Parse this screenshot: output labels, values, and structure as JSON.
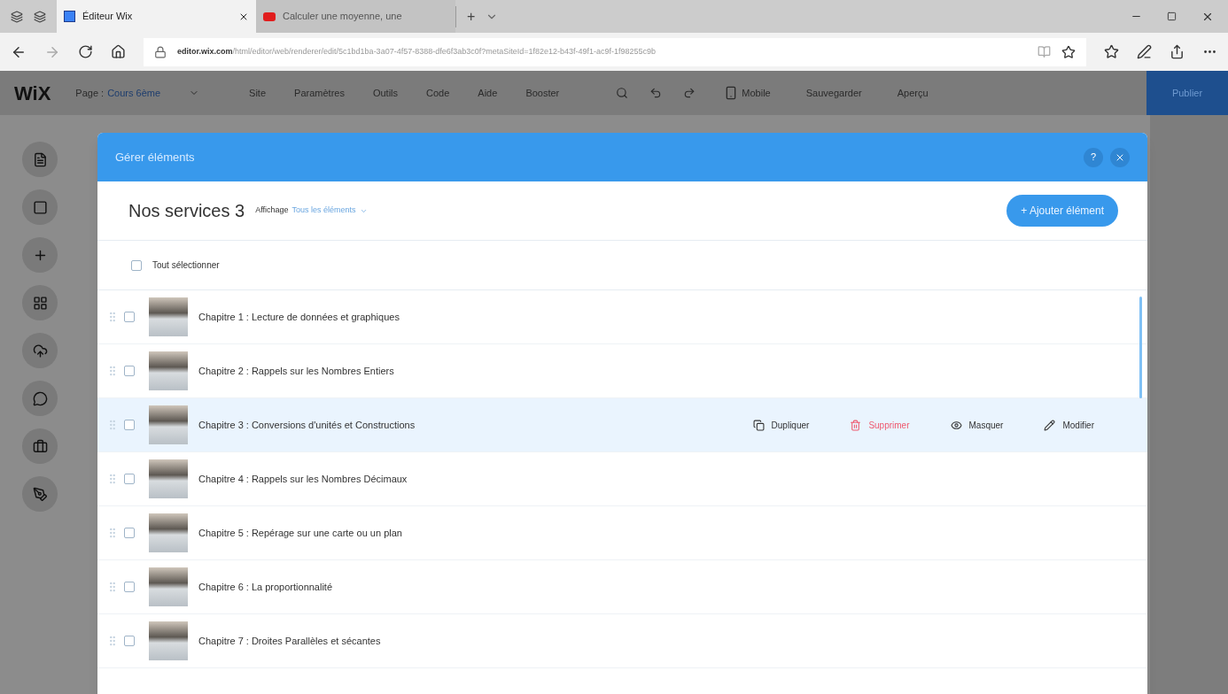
{
  "browser": {
    "tabs": [
      {
        "title": "Éditeur Wix",
        "selected": true,
        "kind": "wix"
      },
      {
        "title": "Calculer une moyenne, une",
        "selected": false,
        "kind": "video"
      }
    ],
    "new_tab": "+",
    "url_domain": "editor.wix.com",
    "url_path": "/html/editor/web/renderer/edit/5c1bd1ba-3a07-4f57-8388-dfe6f3ab3c0f?metaSiteId=1f82e12-b43f-49f1-ac9f-1f98255c9b"
  },
  "editor_bar": {
    "logo": "WiX",
    "page_label": "Page :",
    "page_name": "Cours 6ème",
    "menu": [
      "Site",
      "Paramètres",
      "Outils",
      "Code",
      "Aide",
      "Booster"
    ],
    "mobile": "Mobile",
    "save": "Sauvegarder",
    "preview": "Aperçu",
    "publish": "Publier"
  },
  "dialog": {
    "title": "Gérer éléments",
    "help": "?",
    "collection": "Nos services 3",
    "view_label": "Affichage",
    "view_value": "Tous les éléments",
    "add_button": "+ Ajouter élément",
    "select_all": {
      "label": "Tout sélectionner",
      "checked": false
    },
    "items": [
      {
        "title": "Chapitre 1 : Lecture de données et graphiques",
        "checked": false,
        "selected": false
      },
      {
        "title": "Chapitre 2 : Rappels sur les Nombres Entiers",
        "checked": false,
        "selected": false
      },
      {
        "title": "Chapitre 3 : Conversions d'unités et Constructions",
        "checked": false,
        "selected": true
      },
      {
        "title": "Chapitre 4 : Rappels sur les Nombres Décimaux",
        "checked": false,
        "selected": false
      },
      {
        "title": "Chapitre 5 : Repérage sur une carte ou un plan",
        "checked": false,
        "selected": false
      },
      {
        "title": "Chapitre 6 : La proportionnalité",
        "checked": false,
        "selected": false
      },
      {
        "title": "Chapitre 7 : Droites Parallèles et sécantes",
        "checked": false,
        "selected": false
      }
    ],
    "row_actions": [
      {
        "label": "Dupliquer",
        "kind": "duplicate"
      },
      {
        "label": "Supprimer",
        "kind": "delete"
      },
      {
        "label": "Masquer",
        "kind": "hide"
      },
      {
        "label": "Modifier",
        "kind": "edit"
      }
    ]
  }
}
